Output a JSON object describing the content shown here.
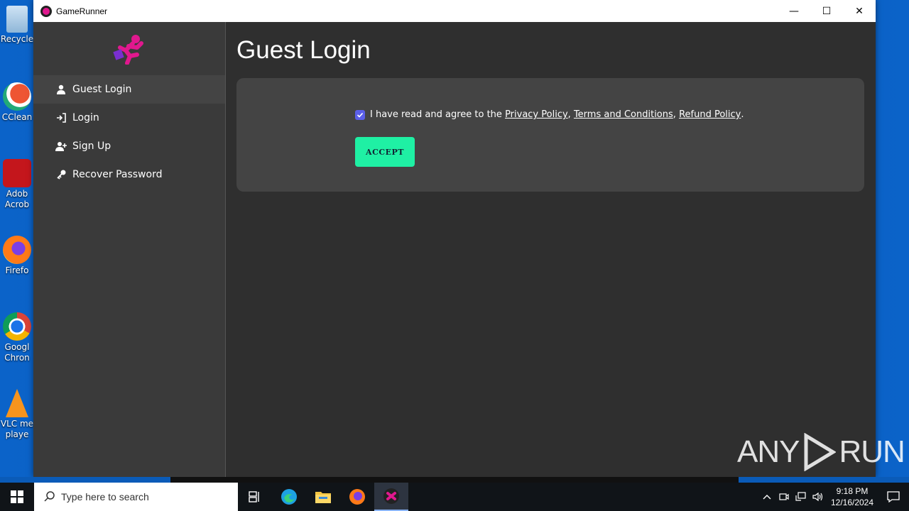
{
  "desktop": {
    "icons": [
      {
        "label": "Recycle",
        "name": "recycle-bin"
      },
      {
        "label": "CClean",
        "name": "ccleaner"
      },
      {
        "label": "Adob",
        "label2": "Acrob",
        "name": "adobe-acrobat"
      },
      {
        "label": "Firefo",
        "name": "firefox"
      },
      {
        "label": "Googl",
        "label2": "Chron",
        "name": "google-chrome"
      },
      {
        "label": "VLC me",
        "label2": "playe",
        "name": "vlc"
      }
    ]
  },
  "window": {
    "title": "GameRunner",
    "minimize": "—",
    "maximize": "☐",
    "close": "✕"
  },
  "sidebar": {
    "items": [
      {
        "label": "Guest Login",
        "icon": "user-icon",
        "active": true
      },
      {
        "label": "Login",
        "icon": "login-icon",
        "active": false
      },
      {
        "label": "Sign Up",
        "icon": "user-plus-icon",
        "active": false
      },
      {
        "label": "Recover Password",
        "icon": "key-icon",
        "active": false
      }
    ]
  },
  "main": {
    "title": "Guest Login",
    "agree_text": "I have read and agree to the",
    "links": [
      "Privacy Policy",
      "Terms and Conditions",
      "Refund Policy"
    ],
    "sep": ",",
    "end": ".",
    "checked": true,
    "accept_label": "ACCEPT"
  },
  "watermark": {
    "left": "ANY",
    "right": "RUN"
  },
  "taskbar": {
    "search_placeholder": "Type here to search",
    "time": "9:18 PM",
    "date": "12/16/2024"
  },
  "colors": {
    "accent": "#1ff0a4",
    "checkbox": "#5b5fe8",
    "logo": "#e0188e"
  }
}
